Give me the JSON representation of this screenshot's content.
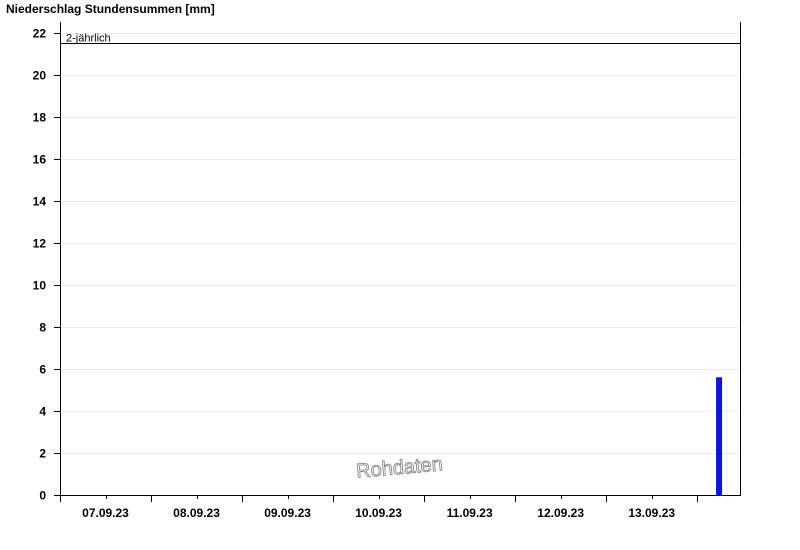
{
  "chart_data": {
    "type": "bar",
    "title": "Niederschlag Stundensummen [mm]",
    "xlabel": "",
    "ylabel": "",
    "ylim": [
      0,
      22.5
    ],
    "y_ticks": [
      0,
      2,
      4,
      6,
      8,
      10,
      12,
      14,
      16,
      18,
      20,
      22
    ],
    "x_range_days": [
      6.0,
      13.47
    ],
    "day_labels": [
      {
        "label": "07.09.23",
        "day": 7
      },
      {
        "label": "08.09.23",
        "day": 8
      },
      {
        "label": "09.09.23",
        "day": 9
      },
      {
        "label": "10.09.23",
        "day": 10
      },
      {
        "label": "11.09.23",
        "day": 11
      },
      {
        "label": "12.09.23",
        "day": 12
      },
      {
        "label": "13.09.23",
        "day": 13
      }
    ],
    "series": [
      {
        "color": "#0a14e6",
        "points": [
          {
            "day": 13.24,
            "value": 5.6
          }
        ]
      }
    ],
    "reference_lines": [
      {
        "label": "2-jährlich",
        "value": 21.5,
        "color": "#000000"
      }
    ],
    "grid": true,
    "watermark": "Rohdaten"
  }
}
